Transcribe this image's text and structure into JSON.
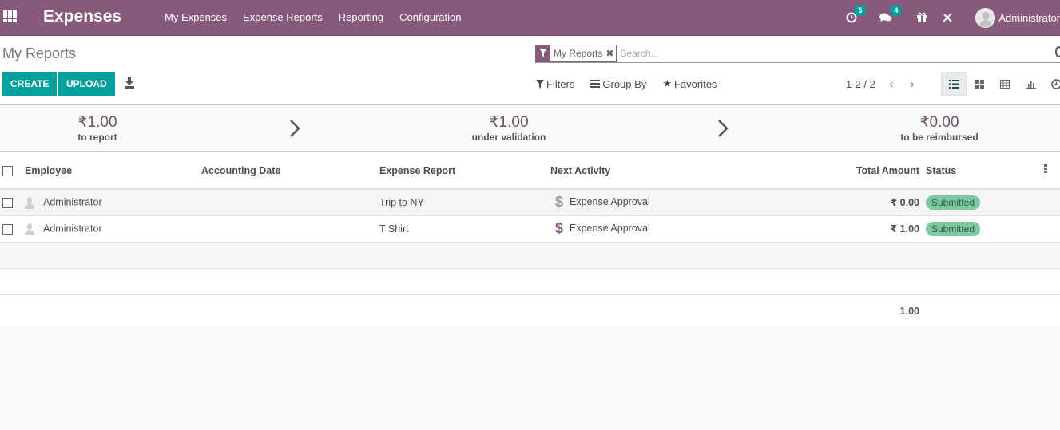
{
  "navbar": {
    "app_title": "Expenses",
    "menu": [
      "My Expenses",
      "Expense Reports",
      "Reporting",
      "Configuration"
    ],
    "activity_count": "5",
    "messages_count": "4",
    "user_name": "Administrator",
    "color": "#875a7b"
  },
  "control_panel": {
    "breadcrumb": "My Reports",
    "create_label": "CREATE",
    "upload_label": "UPLOAD",
    "facet_label": "My Reports",
    "search_placeholder": "Search...",
    "filters_label": "Filters",
    "group_by_label": "Group By",
    "favorites_label": "Favorites",
    "pager": "1-2 / 2",
    "accent_color": "#00a09d"
  },
  "dashboard": {
    "stats": [
      {
        "amount": "₹1.00",
        "label": "to report"
      },
      {
        "amount": "₹1.00",
        "label": "under validation"
      },
      {
        "amount": "₹0.00",
        "label": "to be reimbursed"
      }
    ]
  },
  "table": {
    "headers": {
      "employee": "Employee",
      "accounting_date": "Accounting Date",
      "expense_report": "Expense Report",
      "next_activity": "Next Activity",
      "total_amount": "Total Amount",
      "status": "Status"
    },
    "rows": [
      {
        "employee": "Administrator",
        "accounting_date": "",
        "expense_report": "Trip to NY",
        "next_activity": "Expense Approval",
        "total_amount": "₹ 0.00",
        "status": "Submitted"
      },
      {
        "employee": "Administrator",
        "accounting_date": "",
        "expense_report": "T Shirt",
        "next_activity": "Expense Approval",
        "total_amount": "₹ 1.00",
        "status": "Submitted"
      }
    ],
    "footer_total": "1.00",
    "status_color": "#7ec9a1"
  }
}
